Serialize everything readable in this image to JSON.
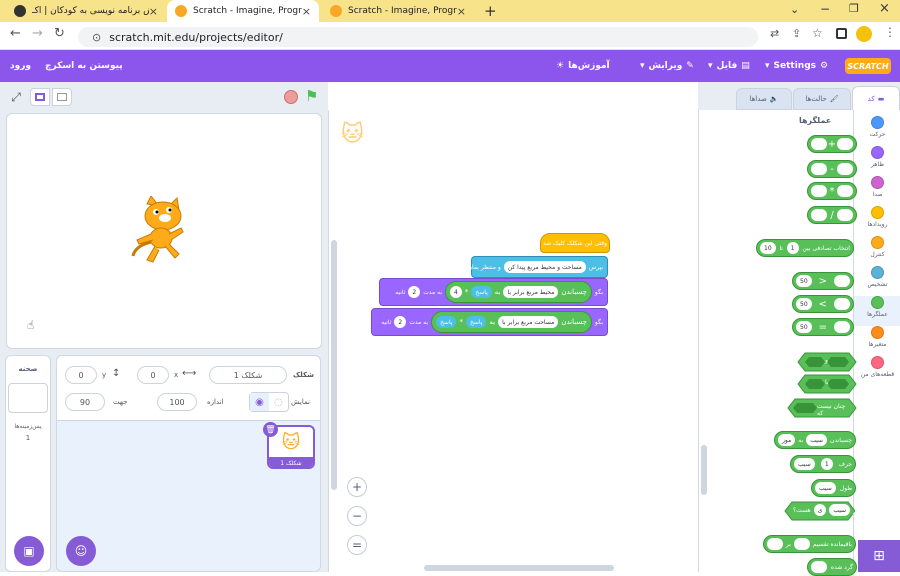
{
  "browser": {
    "tabs": [
      {
        "title": "آموزش برنامه نویسی به کودکان | آکـ"
      },
      {
        "title": "Scratch - Imagine, Program, Shar"
      },
      {
        "title": "Scratch - Imagine, Program, Shar"
      }
    ],
    "url": "scratch.mit.edu/projects/editor/"
  },
  "menu": {
    "logo": "SCRATCH",
    "settings": "Settings",
    "file": "فایل",
    "edit": "ویرایش",
    "tutorials": "آموزش‌ها",
    "join": "پیوستن به اسکرچ",
    "signin": "ورود"
  },
  "editor_tabs": {
    "code": "کد",
    "costumes": "حالت‌ها",
    "sounds": "صداها"
  },
  "categories": [
    {
      "label": "حرکت",
      "color": "#4c97ff"
    },
    {
      "label": "ظاهر",
      "color": "#9966ff"
    },
    {
      "label": "صدا",
      "color": "#cf63cf"
    },
    {
      "label": "رویدادها",
      "color": "#ffbf00"
    },
    {
      "label": "کنترل",
      "color": "#ffab19"
    },
    {
      "label": "تشخیص",
      "color": "#5cb1d6"
    },
    {
      "label": "عملگرها",
      "color": "#59c059"
    },
    {
      "label": "متغیرها",
      "color": "#ff8c1a"
    },
    {
      "label": "قطعه‌های من",
      "color": "#ff6680"
    }
  ],
  "palette": {
    "heading": "عملگرها",
    "ops": [
      "+",
      "-",
      "*",
      "/"
    ],
    "random": {
      "label_a": "انتخاب تصادفی بین",
      "from": "1",
      "to_label": "تا",
      "to": "10"
    },
    "cmp": [
      {
        "sym": ">",
        "val": "50"
      },
      {
        "sym": "<",
        "val": "50"
      },
      {
        "sym": "=",
        "val": "50"
      }
    ],
    "and": "و",
    "or": "یا",
    "not": "چنان نیست که",
    "join": {
      "a": "سیب",
      "b": "موز",
      "label": "چسباندن",
      "mid": "به"
    },
    "letter": {
      "label": "حرف",
      "n": "1",
      "of": "سیب"
    },
    "length": {
      "label": "طول",
      "of": "سیب"
    },
    "contains": {
      "label": "در",
      "a": "سیب",
      "b": "ی",
      "q": "هست؟"
    },
    "mod": {
      "label": "باقیمانده تقسیم",
      "on": "بر"
    },
    "round": "گرد شده"
  },
  "script": {
    "hat": "وقتی این شکلک کلیک شد",
    "ask": {
      "label": "بپرس",
      "text": "مساحت و محیط مربع پیدا کن",
      "tail": "و منتظر بمان"
    },
    "say1": {
      "label": "بگو",
      "join": "چسباندن",
      "text": "محیط مربع برابر با",
      "to": "به",
      "answer": "پاسخ",
      "times": "4",
      "for": "به مدت",
      "secs": "2",
      "unit": "ثانیه"
    },
    "say2": {
      "label": "بگو",
      "join": "چسباندن",
      "text": "مساحت مربع برابر با",
      "to": "به",
      "answer": "پاسخ",
      "answer2": "پاسخ",
      "for": "به مدت",
      "secs": "2",
      "unit": "ثانیه"
    }
  },
  "sprite_info": {
    "sprite_label": "شکلک",
    "name": "شکلک 1",
    "x_label": "x",
    "x": "0",
    "y_label": "y",
    "y": "0",
    "show_label": "نمایش",
    "size_label": "اندازه",
    "size": "100",
    "dir_label": "جهت",
    "dir": "90"
  },
  "sprite_thumb": "شکلک 1",
  "stage_col": {
    "title": "صحنه",
    "backdrops": "پس‌زمینه‌ها",
    "count": "1"
  },
  "zoom": {
    "in": "+",
    "out": "−",
    "reset": "="
  }
}
